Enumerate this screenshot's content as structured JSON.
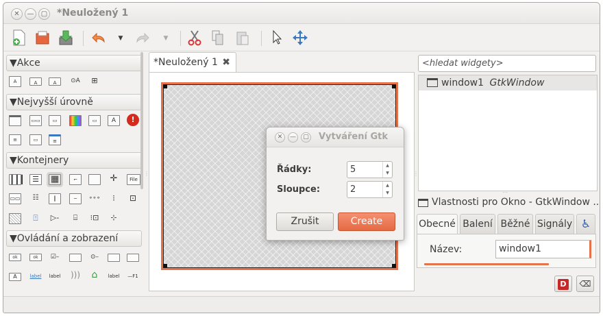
{
  "window": {
    "title": "*Neuložený 1",
    "controls": {
      "close": "✕",
      "minimize": "—",
      "maximize": "▢"
    }
  },
  "toolbar": {
    "icons": [
      "new-file-icon",
      "open-file-icon",
      "save-icon",
      "undo-icon",
      "undo-dropdown-icon",
      "redo-icon",
      "redo-dropdown-icon",
      "cut-icon",
      "copy-icon",
      "paste-icon",
      "pointer-icon",
      "drag-move-icon"
    ]
  },
  "palette": {
    "sections": [
      {
        "label": "Akce",
        "arrow": "▼"
      },
      {
        "label": "Nejvyšší úrovně",
        "arrow": "▼"
      },
      {
        "label": "Kontejnery",
        "arrow": "▼"
      },
      {
        "label": "Ovládání a zobrazení",
        "arrow": "▼"
      }
    ],
    "icon_texts": {
      "action_a1": "A",
      "action_a2": "A",
      "action_a3": "A",
      "action_radio": "⊙A",
      "toplevel_label": "A",
      "filechooser": "File",
      "ok_button": "ok",
      "ok_button2": "ok",
      "label1": "label",
      "label2": "label",
      "label3": "label",
      "f1": "—F1",
      "label_a": "A"
    }
  },
  "editor": {
    "tab_label": "*Neuložený 1",
    "tab_close": "✖"
  },
  "dialog": {
    "title": "Vytváření Gtk",
    "controls": {
      "close": "✕",
      "minimize": "—",
      "maximize": "▢"
    },
    "rows_label": "Řádky:",
    "rows_value": "5",
    "cols_label": "Sloupce:",
    "cols_value": "2",
    "spin_up": "▲",
    "spin_down": "▼",
    "cancel_label": "Zrušit",
    "create_label": "Create"
  },
  "inspector": {
    "search_placeholder": "<hledat widgety>",
    "tree_item_name": "window1",
    "tree_item_type": "GtkWindow"
  },
  "properties": {
    "title": "Vlastnosti pro Okno - GtkWindow ...",
    "tabs": [
      "Obecné",
      "Balení",
      "Běžné",
      "Signály"
    ],
    "accessibility_icon": "♿",
    "name_label": "Název:",
    "name_value": "window1",
    "help_icon_text": "D",
    "clear_icon_text": "⌫"
  },
  "colors": {
    "accent": "#e5734a",
    "background": "#f2f1f0"
  }
}
